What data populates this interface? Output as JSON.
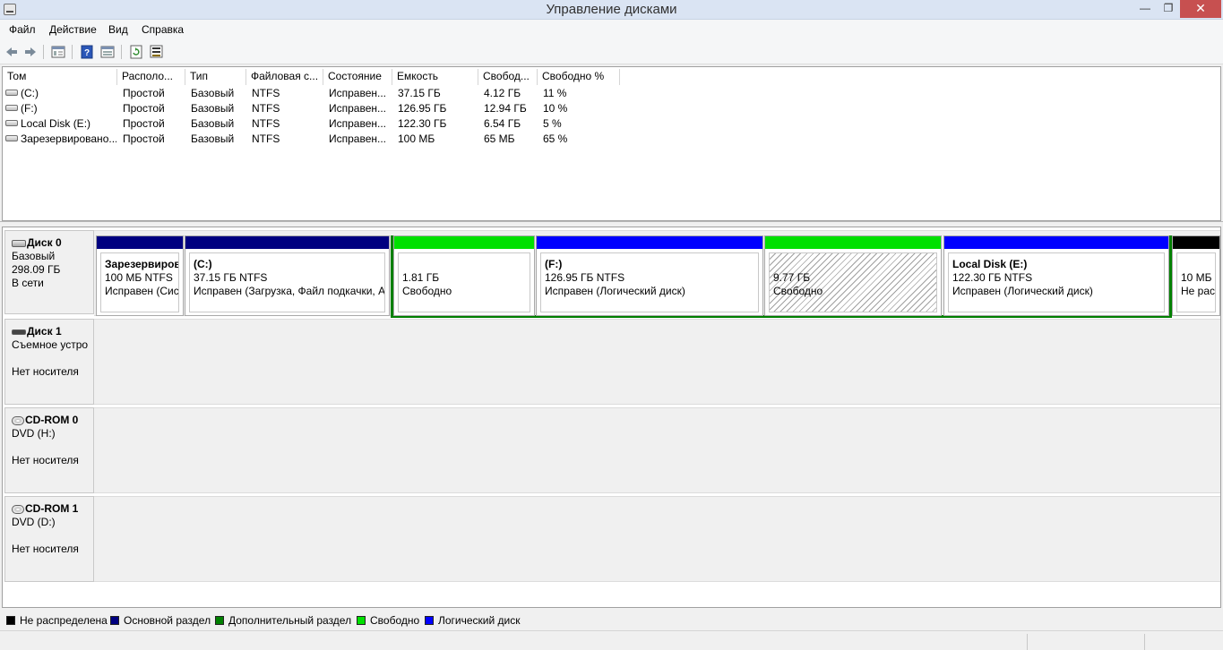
{
  "window": {
    "title": "Управление дисками",
    "minimize": "—",
    "maximize": "❐",
    "close": "✕"
  },
  "menu": [
    "Файл",
    "Действие",
    "Вид",
    "Справка"
  ],
  "toolbar": [
    "back-icon",
    "forward-icon",
    "properties-icon",
    "help-icon",
    "view-icon",
    "refresh-icon",
    "rescan-icon"
  ],
  "volumes": {
    "columns": [
      "Том",
      "Располо...",
      "Тип",
      "Файловая с...",
      "Состояние",
      "Емкость",
      "Свобод...",
      "Свободно %"
    ],
    "rows": [
      [
        "(C:)",
        "Простой",
        "Базовый",
        "NTFS",
        "Исправен...",
        "37.15 ГБ",
        "4.12 ГБ",
        "11 %"
      ],
      [
        "(F:)",
        "Простой",
        "Базовый",
        "NTFS",
        "Исправен...",
        "126.95 ГБ",
        "12.94 ГБ",
        "10 %"
      ],
      [
        "Local Disk (E:)",
        "Простой",
        "Базовый",
        "NTFS",
        "Исправен...",
        "122.30 ГБ",
        "6.54 ГБ",
        "5 %"
      ],
      [
        "Зарезервировано...",
        "Простой",
        "Базовый",
        "NTFS",
        "Исправен...",
        "100 МБ",
        "65 МБ",
        "65 %"
      ]
    ]
  },
  "disks": [
    {
      "name": "Диск 0",
      "line1": "Базовый",
      "line2": "298.09 ГБ",
      "line3": "В сети"
    },
    {
      "name": "Диск 1",
      "line1": "Съемное устро",
      "line2": "",
      "line3": "Нет носителя"
    },
    {
      "name": "CD-ROM 0",
      "line1": "DVD (H:)",
      "line2": "",
      "line3": "Нет носителя"
    },
    {
      "name": "CD-ROM 1",
      "line1": "DVD (D:)",
      "line2": "",
      "line3": "Нет носителя"
    }
  ],
  "partitions": [
    {
      "name": "Зарезервиров",
      "size": "100 МБ NTFS",
      "status": "Исправен (Сист",
      "color": "#000080"
    },
    {
      "name": "(C:)",
      "size": "37.15 ГБ NTFS",
      "status": "Исправен (Загрузка, Файл подкачки, А",
      "color": "#000080"
    },
    {
      "name": "",
      "size": "1.81 ГБ",
      "status": "Свободно",
      "color": "#00e000"
    },
    {
      "name": "(F:)",
      "size": "126.95 ГБ NTFS",
      "status": "Исправен (Логический диск)",
      "color": "#0000ff"
    },
    {
      "name": "",
      "size": "9.77 ГБ",
      "status": "Свободно",
      "color": "#00e000"
    },
    {
      "name": "Local Disk  (E:)",
      "size": "122.30 ГБ NTFS",
      "status": "Исправен (Логический диск)",
      "color": "#0000ff"
    },
    {
      "name": "",
      "size": "10 МБ",
      "status": "Не рас",
      "color": "#000000"
    }
  ],
  "legend": [
    {
      "label": "Не распределена",
      "color": "#000000"
    },
    {
      "label": "Основной раздел",
      "color": "#000080"
    },
    {
      "label": "Дополнительный раздел",
      "color": "#008000"
    },
    {
      "label": "Свободно",
      "color": "#00e000"
    },
    {
      "label": "Логический диск",
      "color": "#0000ff"
    }
  ]
}
